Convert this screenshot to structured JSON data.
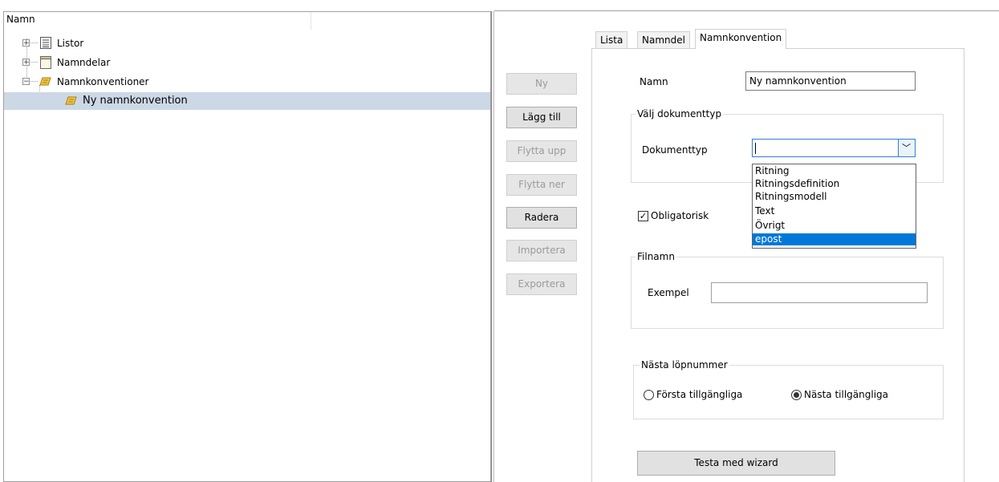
{
  "tree": {
    "column_header": "Namn",
    "items": [
      {
        "label": "Listor",
        "icon": "list-icon",
        "expander": "+"
      },
      {
        "label": "Namndelar",
        "icon": "document-icon",
        "expander": "+"
      },
      {
        "label": "Namnkonventioner",
        "icon": "naming-folder-icon",
        "expander": "−"
      },
      {
        "label": "Ny namnkonvention",
        "icon": "naming-convention-icon"
      }
    ]
  },
  "buttons": {
    "ny": "Ny",
    "lagg_till": "Lägg till",
    "flytta_upp": "Flytta upp",
    "flytta_ner": "Flytta ner",
    "radera": "Radera",
    "importera": "Importera",
    "exportera": "Exportera"
  },
  "tabs": [
    "Lista",
    "Namndel",
    "Namnkonvention"
  ],
  "form": {
    "namn_label": "Namn",
    "namn_value": "Ny namnkonvention",
    "doc_group_title": "Välj dokumenttyp",
    "dokumenttyp_label": "Dokumenttyp",
    "dokumenttyp_value": "",
    "dropdown_options": [
      "Ritning",
      "Ritningsdefinition",
      "Ritningsmodell",
      "Text",
      "Övrigt",
      "epost"
    ],
    "obligatorisk_label": "Obligatorisk",
    "obligatorisk_checked": true,
    "filnamn_group_title": "Filnamn",
    "exempel_label": "Exempel",
    "exempel_value": "",
    "lopnummer_group_title": "Nästa löpnummer",
    "radio_forsta": "Första tillgängliga",
    "radio_nasta": "Nästa tillgängliga",
    "radio_selected": "Nästa tillgängliga",
    "wizard_button": "Testa med wizard"
  }
}
